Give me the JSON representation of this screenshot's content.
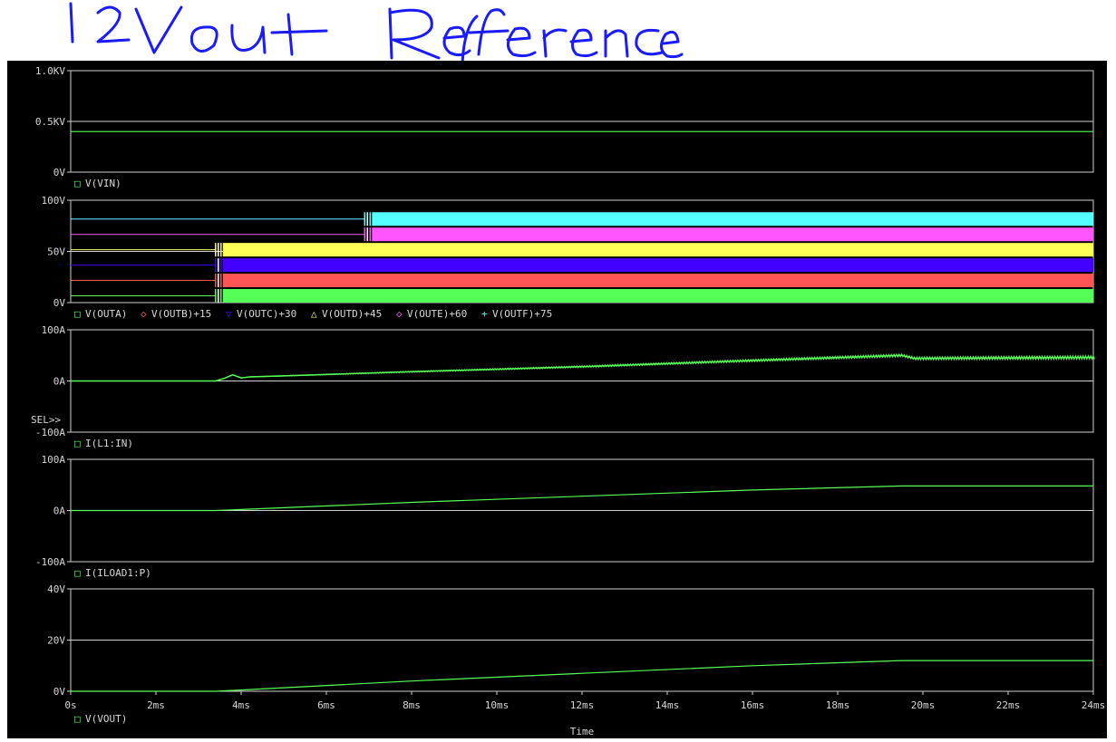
{
  "annotation": {
    "handwritten_title": "12Vout Reference",
    "ink_color": "#1a1aff"
  },
  "colors": {
    "background": "#000000",
    "grid": "#cfcfcf",
    "text": "#d8d8d8",
    "trace_green": "#55ff55",
    "trace_red": "#ff5555",
    "trace_blue": "#4400ff",
    "trace_yellow": "#ffff55",
    "trace_magenta": "#ff55ff",
    "trace_cyan": "#55ffff"
  },
  "x_axis": {
    "label": "Time",
    "tick_labels": [
      "0s",
      "2ms",
      "4ms",
      "6ms",
      "8ms",
      "10ms",
      "12ms",
      "14ms",
      "16ms",
      "18ms",
      "20ms",
      "22ms",
      "24ms"
    ]
  },
  "sel_marker": "SEL>>",
  "chart_data": [
    {
      "type": "line",
      "ylabels": [
        "1.0KV",
        "0.5KV",
        "0V"
      ],
      "ylim": [
        0,
        1000
      ],
      "xlim": [
        0,
        24
      ],
      "series": [
        {
          "name": "V(VIN)",
          "marker": "□",
          "color": "#55ff55",
          "x": [
            0,
            24
          ],
          "y": [
            400,
            400
          ]
        }
      ]
    },
    {
      "type": "area",
      "ylabels": [
        "100V",
        "50V",
        "0V"
      ],
      "ylim": [
        0,
        100
      ],
      "xlim": [
        0,
        24
      ],
      "series": [
        {
          "name": "V(OUTA)",
          "marker": "□",
          "color": "#55ff55",
          "offset": 0,
          "start_ms": 3.4,
          "high": 12,
          "level_before": 0
        },
        {
          "name": "V(OUTB)+15",
          "marker": "◇",
          "color": "#ff5555",
          "offset": 15,
          "start_ms": 3.4,
          "high": 12,
          "level_before": 0
        },
        {
          "name": "V(OUTC)+30",
          "marker": "▽",
          "color": "#4400ff",
          "offset": 30,
          "start_ms": 3.4,
          "high": 12,
          "level_before": 0
        },
        {
          "name": "V(OUTD)+45",
          "marker": "△",
          "color": "#ffff55",
          "offset": 45,
          "start_ms": 3.4,
          "high": 12,
          "level_before": 0
        },
        {
          "name": "V(OUTE)+60",
          "marker": "◇",
          "color": "#ff55ff",
          "offset": 60,
          "start_ms": 6.9,
          "high": 12,
          "level_before": 0
        },
        {
          "name": "V(OUTF)+75",
          "marker": "+",
          "color": "#55ffff",
          "offset": 75,
          "start_ms": 6.9,
          "high": 12,
          "level_before": 0
        }
      ]
    },
    {
      "type": "line",
      "ylabels": [
        "100A",
        "0A",
        "-100A"
      ],
      "ylim": [
        -100,
        100
      ],
      "xlim": [
        0,
        24
      ],
      "selected": true,
      "series": [
        {
          "name": "I(L1:IN)",
          "marker": "□",
          "color": "#55ff55",
          "x": [
            0,
            3.4,
            3.6,
            3.8,
            4.0,
            4.2,
            5,
            8,
            12,
            16,
            19.5,
            19.8,
            24
          ],
          "y": [
            0,
            0,
            5,
            12,
            6,
            8,
            10,
            18,
            28,
            40,
            50,
            44,
            46
          ],
          "ripple": 6
        }
      ]
    },
    {
      "type": "line",
      "ylabels": [
        "100A",
        "0A",
        "-100A"
      ],
      "ylim": [
        -100,
        100
      ],
      "xlim": [
        0,
        24
      ],
      "series": [
        {
          "name": "I(ILOAD1:P)",
          "marker": "□",
          "color": "#55ff55",
          "x": [
            0,
            3.4,
            4,
            8,
            12,
            16,
            19.5,
            24
          ],
          "y": [
            0,
            0,
            2,
            16,
            28,
            40,
            48,
            48
          ]
        }
      ]
    },
    {
      "type": "line",
      "ylabels": [
        "40V",
        "20V",
        "0V"
      ],
      "ylim": [
        0,
        40
      ],
      "xlim": [
        0,
        24
      ],
      "series": [
        {
          "name": "V(VOUT)",
          "marker": "□",
          "color": "#55ff55",
          "x": [
            0,
            3.4,
            4,
            8,
            12,
            16,
            19.5,
            24
          ],
          "y": [
            0,
            0,
            0.5,
            4,
            7,
            10,
            12,
            12
          ]
        }
      ]
    }
  ]
}
